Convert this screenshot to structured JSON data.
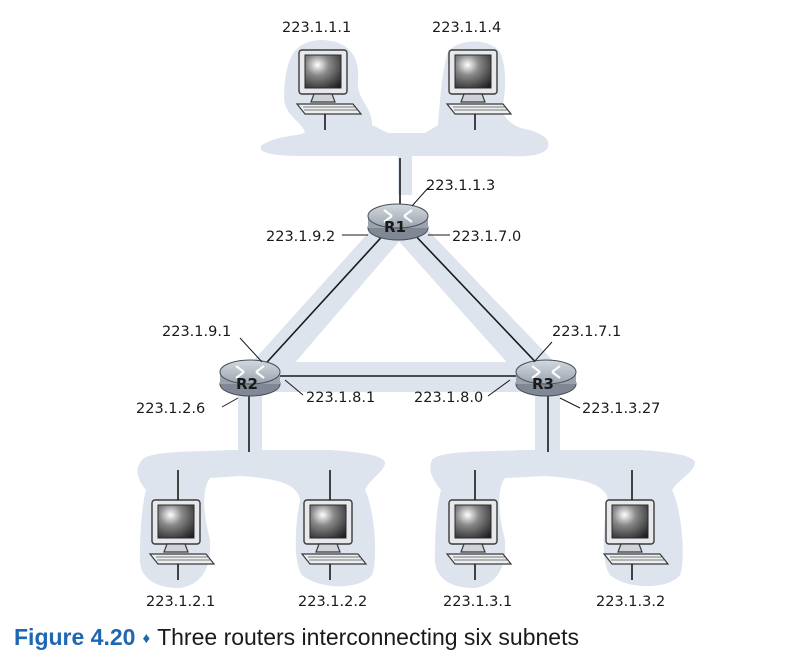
{
  "routers": [
    {
      "id": "R1",
      "label": "R1"
    },
    {
      "id": "R2",
      "label": "R2"
    },
    {
      "id": "R3",
      "label": "R3"
    }
  ],
  "hosts": [
    {
      "id": "h1",
      "label": "223.1.1.1"
    },
    {
      "id": "h2",
      "label": "223.1.1.4"
    },
    {
      "id": "h3",
      "label": "223.1.2.1"
    },
    {
      "id": "h4",
      "label": "223.1.2.2"
    },
    {
      "id": "h5",
      "label": "223.1.3.1"
    },
    {
      "id": "h6",
      "label": "223.1.3.2"
    }
  ],
  "interfaces": {
    "r1_lan": "223.1.1.3",
    "r1_to_r2": "223.1.9.2",
    "r1_to_r3": "223.1.7.0",
    "r2_to_r1": "223.1.9.1",
    "r3_to_r1": "223.1.7.1",
    "r2_to_r3": "223.1.8.1",
    "r3_to_r2": "223.1.8.0",
    "r2_lan": "223.1.2.6",
    "r3_lan": "223.1.3.27"
  },
  "caption": {
    "figure_label": "Figure 4.20",
    "separator": "♦",
    "text": "Three routers interconnecting six subnets"
  },
  "colors": {
    "subnet_fill": "#dde4ee",
    "router_fill": "#b9c1cc",
    "caption_accent": "#1f67b1"
  }
}
